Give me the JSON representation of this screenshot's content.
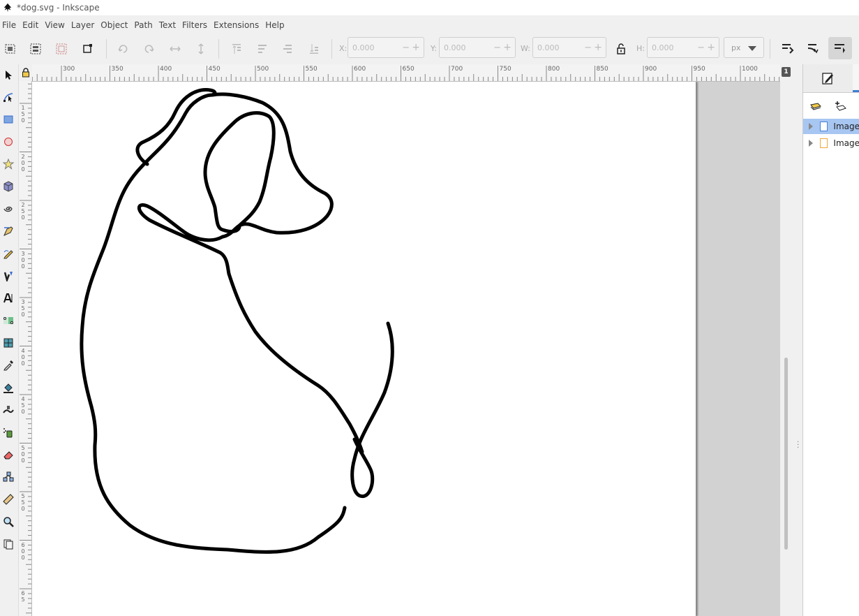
{
  "window": {
    "title": "*dog.svg - Inkscape"
  },
  "menu": [
    "File",
    "Edit",
    "View",
    "Layer",
    "Object",
    "Path",
    "Text",
    "Filters",
    "Extensions",
    "Help"
  ],
  "toolbar": {
    "x_label": "X:",
    "x_value": "0.000",
    "y_label": "Y:",
    "y_value": "0.000",
    "w_label": "W:",
    "w_value": "0.000",
    "h_label": "H:",
    "h_value": "0.000",
    "units": "px",
    "minus": "−",
    "plus": "+"
  },
  "ruler": {
    "h_labels": [
      "300",
      "350",
      "400",
      "450",
      "500",
      "550",
      "600",
      "650",
      "700",
      "750",
      "800",
      "850",
      "900",
      "950",
      "1000"
    ],
    "v_labels": [
      "1\n5\n0",
      "2\n0\n0",
      "2\n5\n0",
      "3\n0\n0",
      "3\n5\n0",
      "4\n0\n0",
      "4\n5\n0",
      "5\n0\n0",
      "5\n5\n0",
      "6\n0\n0",
      "6\n5"
    ]
  },
  "page_badge": "1",
  "objects": [
    {
      "label": "Image",
      "selected": true,
      "icon": "blue-document-icon"
    },
    {
      "label": "Image",
      "selected": false,
      "icon": "orange-document-icon"
    }
  ],
  "colors": {
    "accent": "#3b7fd4",
    "selection": "#a7c6f2",
    "canvas_bg": "#d2d2d2",
    "stroke": "#000000"
  }
}
